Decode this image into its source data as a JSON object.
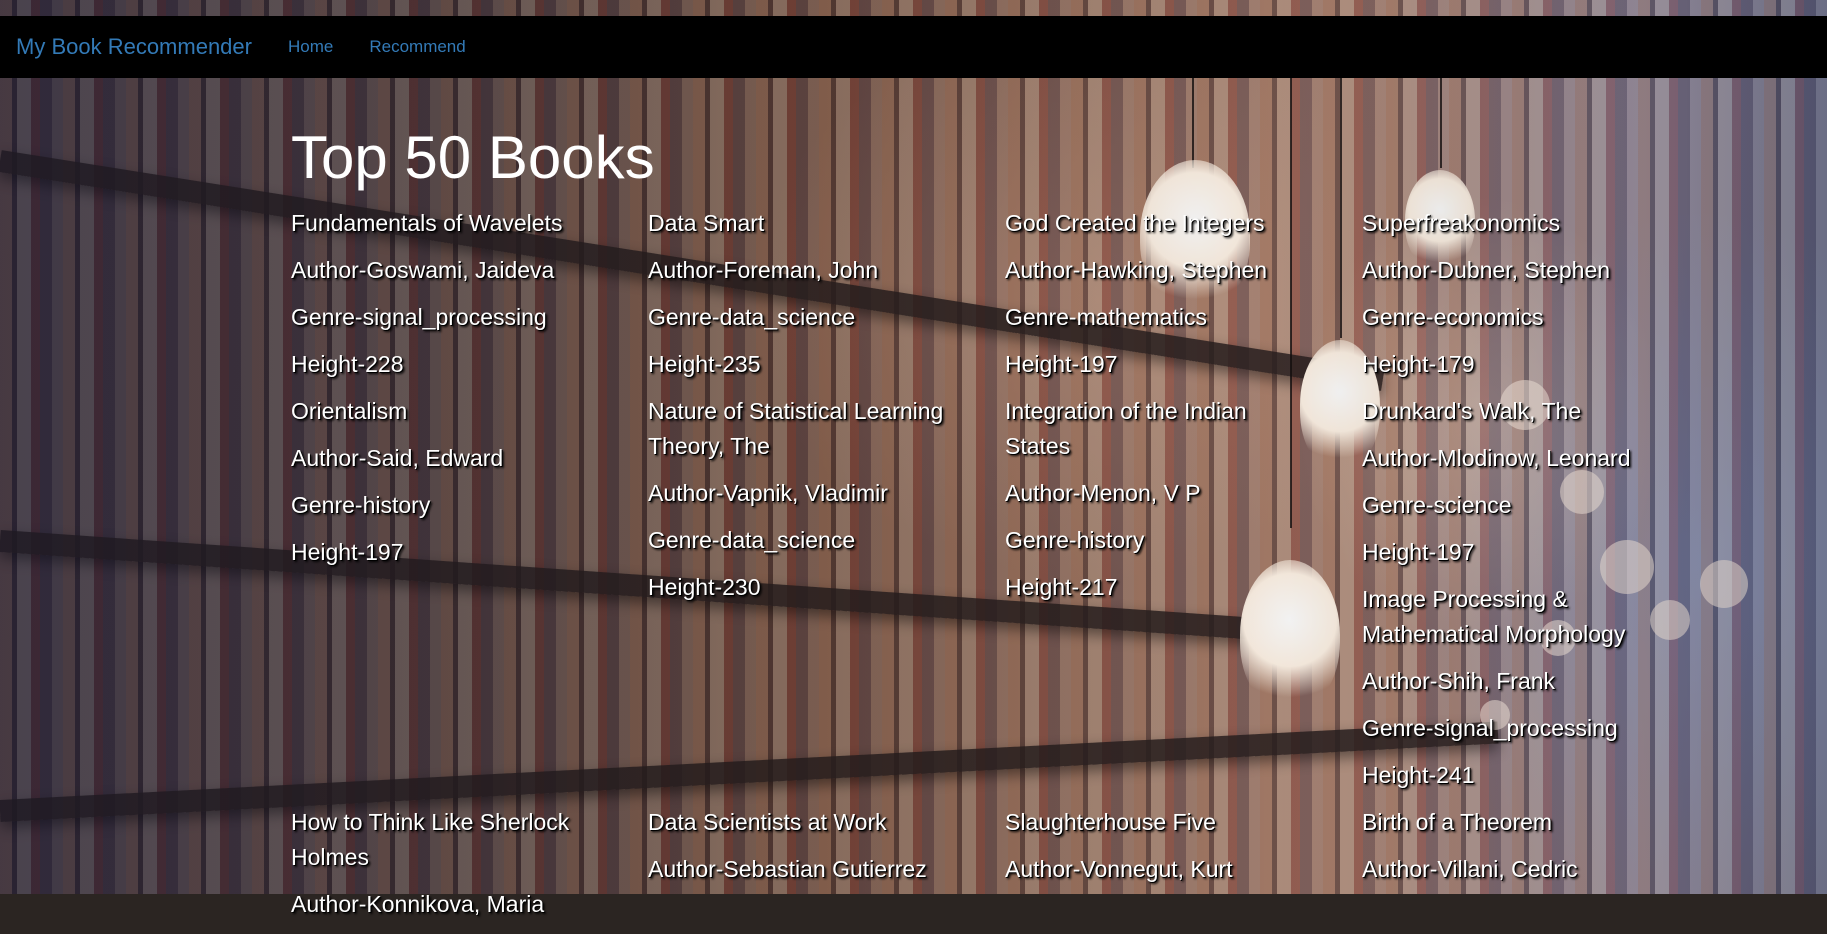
{
  "navbar": {
    "brand": "My Book Recommender",
    "links": [
      "Home",
      "Recommend"
    ]
  },
  "main": {
    "title": "Top 50 Books",
    "books": [
      {
        "title": "Fundamentals of Wavelets",
        "author": "Author-Goswami, Jaideva",
        "genre": "Genre-signal_processing",
        "height": "Height-228"
      },
      {
        "title": "Data Smart",
        "author": "Author-Foreman, John",
        "genre": "Genre-data_science",
        "height": "Height-235"
      },
      {
        "title": "God Created the Integers",
        "author": "Author-Hawking, Stephen",
        "genre": "Genre-mathematics",
        "height": "Height-197"
      },
      {
        "title": "Superfreakonomics",
        "author": "Author-Dubner, Stephen",
        "genre": "Genre-economics",
        "height": "Height-179"
      },
      {
        "title": "Orientalism",
        "author": "Author-Said, Edward",
        "genre": "Genre-history",
        "height": "Height-197"
      },
      {
        "title": "Nature of Statistical Learning Theory, The",
        "author": "Author-Vapnik, Vladimir",
        "genre": "Genre-data_science",
        "height": "Height-230"
      },
      {
        "title": "Integration of the Indian States",
        "author": "Author-Menon, V P",
        "genre": "Genre-history",
        "height": "Height-217"
      },
      {
        "title": "Drunkard's Walk, The",
        "author": "Author-Mlodinow, Leonard",
        "genre": "Genre-science",
        "height": "Height-197"
      },
      {
        "title": "Image Processing & Mathematical Morphology",
        "author": "Author-Shih, Frank",
        "genre": "Genre-signal_processing",
        "height": "Height-241"
      },
      {
        "title": "How to Think Like Sherlock Holmes",
        "author": "Author-Konnikova, Maria",
        "genre": "",
        "height": ""
      },
      {
        "title": "Data Scientists at Work",
        "author": "Author-Sebastian Gutierrez",
        "genre": "",
        "height": ""
      },
      {
        "title": "Slaughterhouse Five",
        "author": "Author-Vonnegut, Kurt",
        "genre": "",
        "height": ""
      },
      {
        "title": "Birth of a Theorem",
        "author": "Author-Villani, Cedric",
        "genre": "",
        "height": ""
      }
    ]
  },
  "colors": {
    "navbar_bg": "#000000",
    "link": "#337ab7",
    "text": "#ffffff"
  }
}
